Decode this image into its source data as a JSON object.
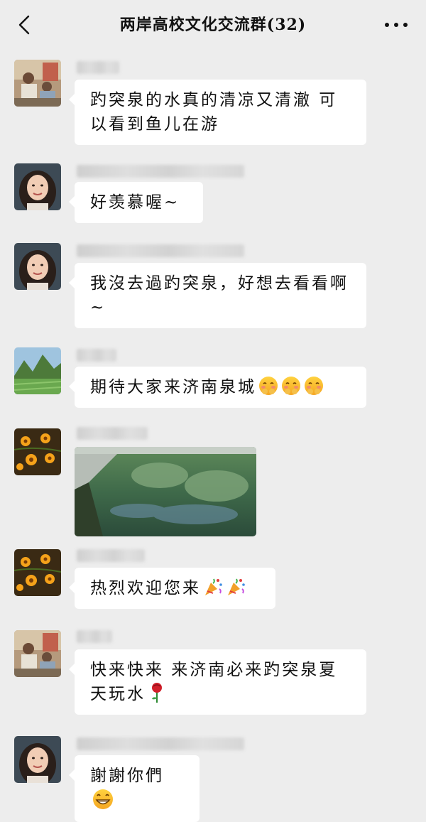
{
  "header": {
    "title": "两岸高校文化交流群(32)",
    "back_icon": "chevron-left-icon",
    "more_icon": "more-dots-icon"
  },
  "messages": [
    {
      "avatar": "avatar-family-photo",
      "text": "趵突泉的水真的清凉又清澈 可以看到鱼儿在游"
    },
    {
      "avatar": "avatar-woman-portrait",
      "text": "好羡慕喔~"
    },
    {
      "avatar": "avatar-woman-portrait",
      "text": "我沒去過趵突泉，好想去看看啊~"
    },
    {
      "avatar": "avatar-green-landscape",
      "text": "期待大家来济南泉城",
      "emojis": [
        "blushing-face-emoji",
        "blushing-face-emoji",
        "blushing-face-emoji"
      ]
    },
    {
      "avatar": "avatar-yellow-flowers",
      "image": "spring-pool-photo"
    },
    {
      "avatar": "avatar-yellow-flowers",
      "text": "热烈欢迎您来",
      "emojis": [
        "party-popper-emoji",
        "party-popper-emoji"
      ]
    },
    {
      "avatar": "avatar-family-photo",
      "text": "快来快来 来济南必来趵突泉夏天玩水",
      "emojis": [
        "rose-emoji"
      ]
    },
    {
      "avatar": "avatar-woman-portrait",
      "text": "謝謝你們",
      "emojis": [
        "grinning-face-emoji"
      ]
    }
  ],
  "colors": {
    "background": "#ededed",
    "bubble": "#ffffff",
    "text": "#111111"
  }
}
